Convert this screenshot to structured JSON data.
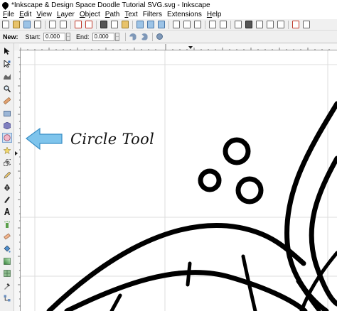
{
  "window": {
    "title": "*Inkscape & Design Space Doodle Tutorial SVG.svg - Inkscape"
  },
  "menubar": {
    "items": [
      {
        "key": "F",
        "rest": "ile"
      },
      {
        "key": "E",
        "rest": "dit"
      },
      {
        "key": "V",
        "rest": "iew"
      },
      {
        "key": "L",
        "rest": "ayer"
      },
      {
        "key": "O",
        "rest": "bject"
      },
      {
        "key": "P",
        "rest": "ath"
      },
      {
        "key": "T",
        "rest": "ext"
      },
      {
        "key": "",
        "rest": "Filters"
      },
      {
        "key": "",
        "rest": "Extensions"
      },
      {
        "key": "H",
        "rest": "elp"
      }
    ]
  },
  "tool_controls": {
    "mode_label": "New:",
    "start_label": "Start:",
    "start_value": "0.000",
    "end_label": "End:",
    "end_value": "0.000"
  },
  "tools": [
    {
      "name": "selector-tool",
      "icon": "arrow-icon"
    },
    {
      "name": "node-tool",
      "icon": "node-icon"
    },
    {
      "name": "tweak-tool",
      "icon": "tweak-icon"
    },
    {
      "name": "zoom-tool",
      "icon": "zoom-icon"
    },
    {
      "name": "measure-tool",
      "icon": "measure-icon"
    },
    {
      "name": "rectangle-tool",
      "icon": "rectangle-icon"
    },
    {
      "name": "box-3d-tool",
      "icon": "cube-icon"
    },
    {
      "name": "circle-tool",
      "icon": "circle-icon",
      "active": true
    },
    {
      "name": "star-tool",
      "icon": "star-icon"
    },
    {
      "name": "spiral-tool",
      "icon": "spiral-icon"
    },
    {
      "name": "pencil-tool",
      "icon": "pencil-icon"
    },
    {
      "name": "pen-tool",
      "icon": "pen-icon"
    },
    {
      "name": "calligraphy-tool",
      "icon": "calligraphy-icon"
    },
    {
      "name": "text-tool",
      "icon": "text-icon"
    },
    {
      "name": "spray-tool",
      "icon": "spray-icon"
    },
    {
      "name": "eraser-tool",
      "icon": "eraser-icon"
    },
    {
      "name": "paint-bucket-tool",
      "icon": "bucket-icon"
    },
    {
      "name": "gradient-tool",
      "icon": "gradient-icon"
    },
    {
      "name": "mesh-tool",
      "icon": "mesh-icon"
    },
    {
      "name": "dropper-tool",
      "icon": "dropper-icon"
    },
    {
      "name": "connector-tool",
      "icon": "connector-icon"
    }
  ],
  "annotation": {
    "label": "Circle Tool",
    "arrow_color": "#7ec4ec"
  },
  "colors": {
    "active_tool_bg": "#cfe0f2",
    "canvas": "#ffffff",
    "grid": "#d8d8d8",
    "drawing_stroke": "#000000"
  }
}
